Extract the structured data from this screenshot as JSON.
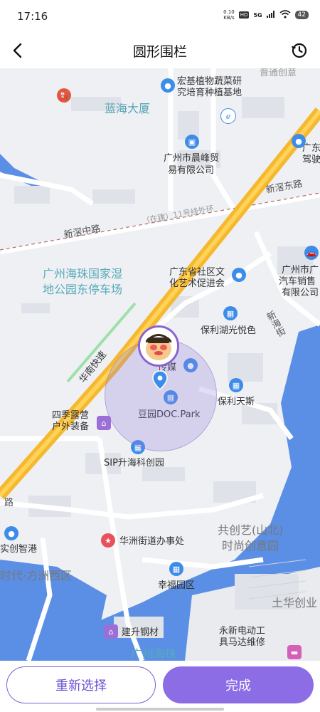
{
  "status": {
    "time": "17:16",
    "net_speed_value": "0.10",
    "net_speed_unit": "KB/s",
    "hd": "HD",
    "signal": "5G",
    "battery": "42"
  },
  "header": {
    "title": "圆形围栏"
  },
  "map": {
    "labels": {
      "lanhai": "蓝海大厦",
      "honji_1": "宏基植物蔬菜研",
      "honji_2": "究培育种植基地",
      "putong": "晋通创意",
      "guangdong_jiashi_1": "广东",
      "guangdong_jiashi_2": "驾驶",
      "chenfeng_1": "广州市晨峰贸",
      "chenfeng_2": "易有限公司",
      "xinjiao_east": "新滘东路",
      "xinjiao_mid": "新滘中路",
      "metro": "（在建）11号线外环",
      "haizhu_park_1": "广州海珠国家湿",
      "haizhu_park_2": "地公园东停车场",
      "community_1": "广东省社区文",
      "community_2": "化艺术促进会",
      "auto_1": "广州市广",
      "auto_2": "汽车销售",
      "auto_3": "有限公司",
      "xinhai": "新海街",
      "poly_hu": "保利湖光悦色",
      "huanan": "华南快速",
      "media": "传媒",
      "poly_tiansi": "保利天斯",
      "douyuan": "豆园DOC.Park",
      "siji_1": "四季露营",
      "siji_2": "户外装备",
      "sip": "SIP升海科创园",
      "lu": "路",
      "gongchuang_1": "共创艺(山北)",
      "gongchuang_2": "时尚创意园",
      "shichuang": "实创智港",
      "huazhou_office": "华洲街道办事处",
      "fangzhou": "时代·方洲西区",
      "xingfu": "幸福园区",
      "tuhua": "土华创业",
      "jiansheng": "建升钢材",
      "yongxin_1": "永新电动工",
      "yongxin_2": "具马达维修",
      "haizhu_bottom": "广州海珠"
    }
  },
  "buttons": {
    "reselect": "重新选择",
    "done": "完成"
  },
  "colors": {
    "accent": "#8c6de6",
    "water": "#5b8fe6",
    "expressway": "#f5b82e"
  }
}
